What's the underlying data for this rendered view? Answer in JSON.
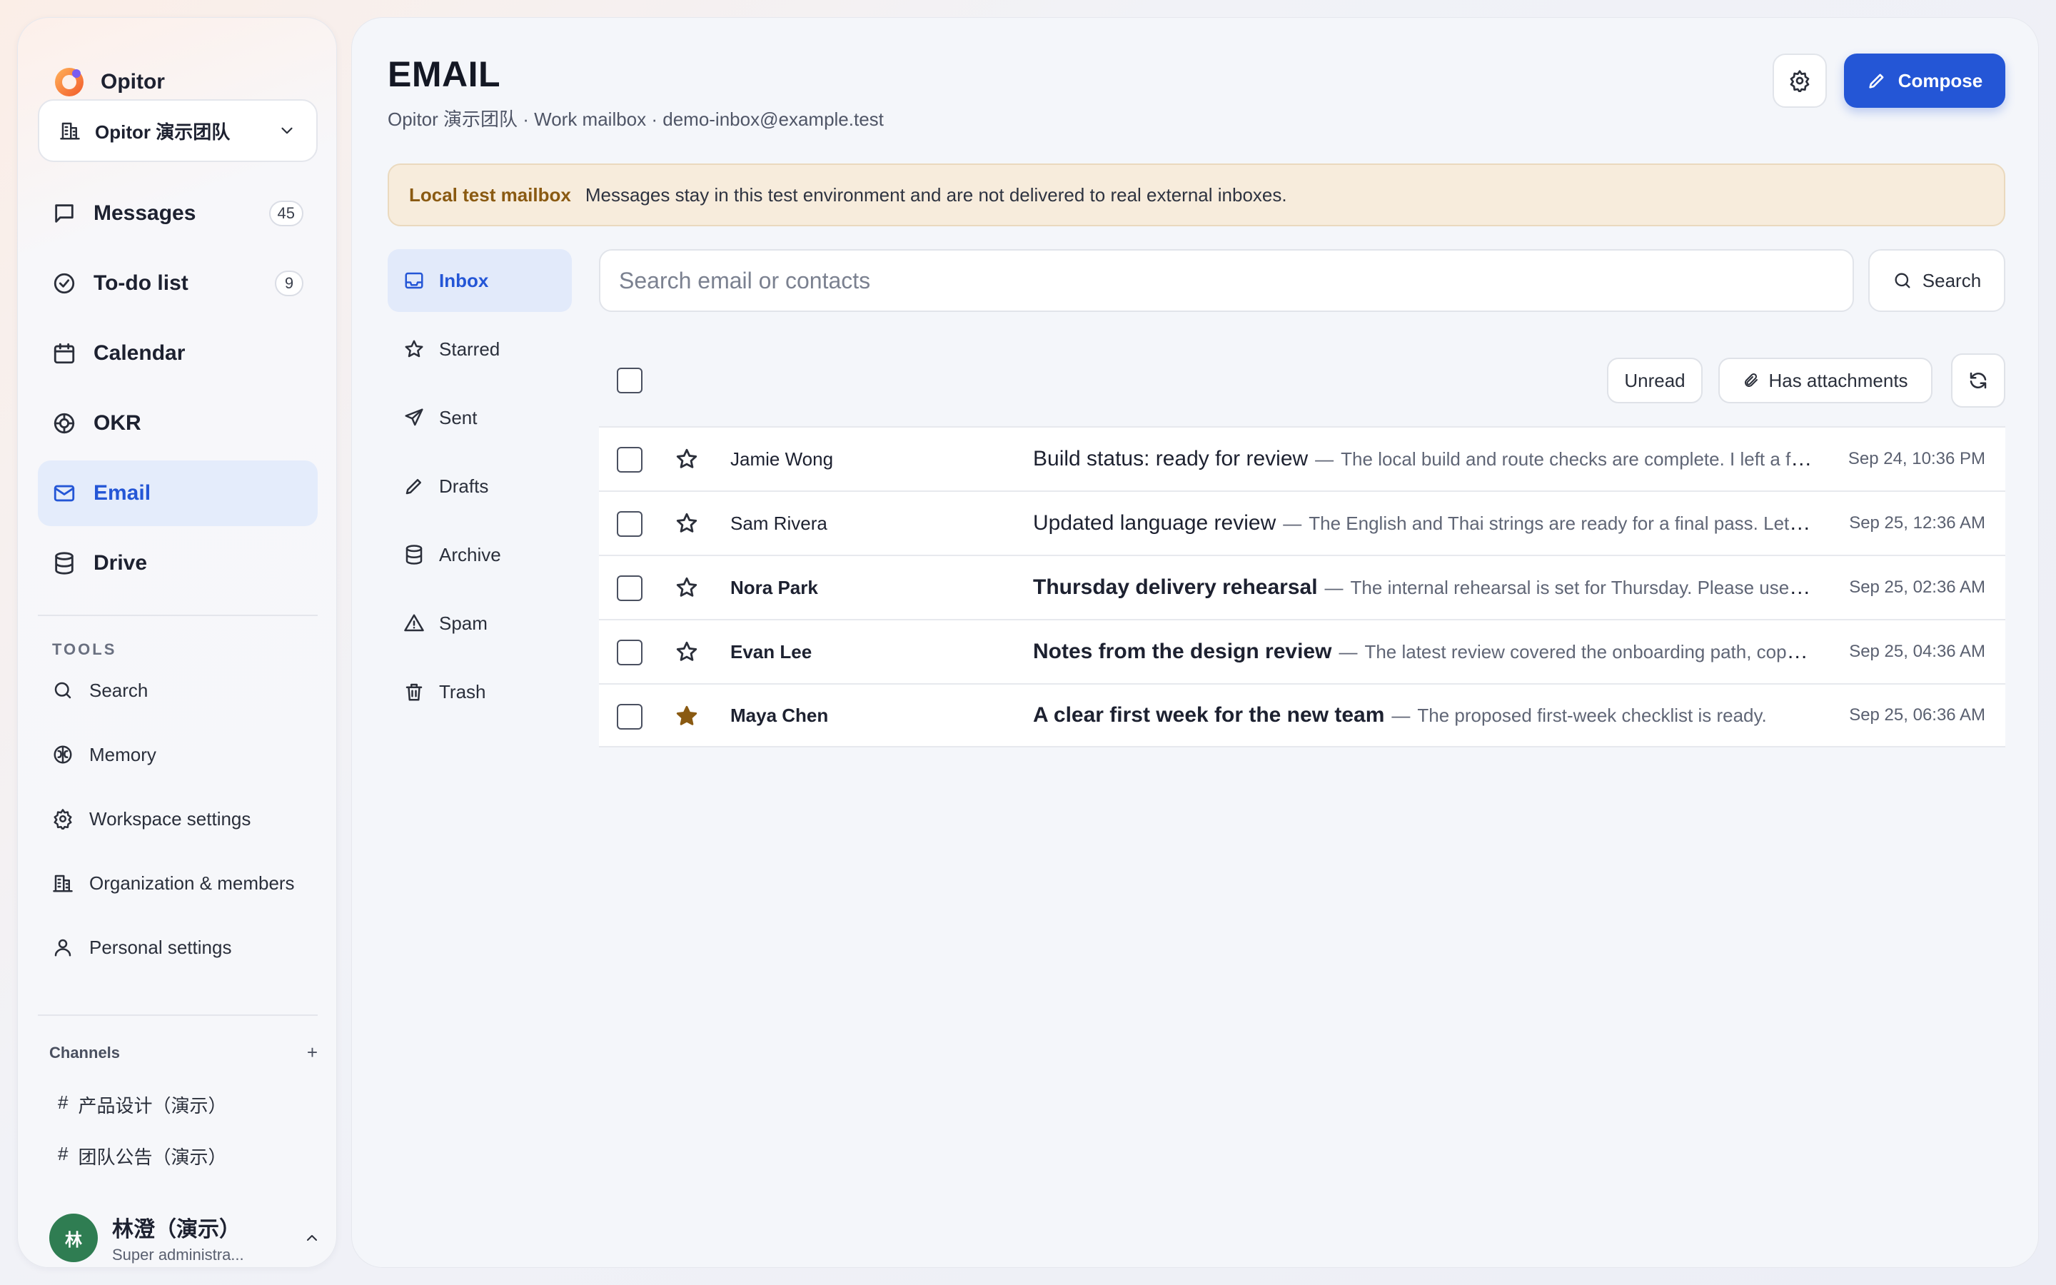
{
  "brand": {
    "name": "Opitor"
  },
  "workspace": {
    "name": "Opitor 演示团队"
  },
  "nav": [
    {
      "label": "Messages",
      "badge": "45",
      "icon": "message-icon"
    },
    {
      "label": "To-do list",
      "badge": "9",
      "icon": "check-circle-icon"
    },
    {
      "label": "Calendar",
      "badge": "",
      "icon": "calendar-icon"
    },
    {
      "label": "OKR",
      "badge": "",
      "icon": "target-icon"
    },
    {
      "label": "Email",
      "badge": "",
      "icon": "mail-icon",
      "active": true
    },
    {
      "label": "Drive",
      "badge": "",
      "icon": "database-icon"
    }
  ],
  "tools": {
    "title": "TOOLS",
    "items": [
      {
        "label": "Search",
        "icon": "search-icon"
      },
      {
        "label": "Memory",
        "icon": "brain-icon"
      },
      {
        "label": "Workspace settings",
        "icon": "gear-icon"
      },
      {
        "label": "Organization & members",
        "icon": "building-icon"
      },
      {
        "label": "Personal settings",
        "icon": "user-icon"
      }
    ]
  },
  "channels": {
    "title": "Channels",
    "add": "+",
    "items": [
      {
        "hash": "#",
        "label": "产品设计（演示）"
      },
      {
        "hash": "#",
        "label": "团队公告（演示）"
      }
    ]
  },
  "user": {
    "avatar": "林",
    "name": "林澄（演示）",
    "role": "Super administra..."
  },
  "header": {
    "title": "EMAIL",
    "subtitle": "Opitor 演示团队 · Work mailbox · demo-inbox@example.test",
    "compose_label": "Compose"
  },
  "notice": {
    "tag": "Local test mailbox",
    "text": "Messages stay in this test environment and are not delivered to real external inboxes."
  },
  "folders": [
    {
      "label": "Inbox",
      "icon": "inbox-icon",
      "active": true
    },
    {
      "label": "Starred",
      "icon": "star-icon"
    },
    {
      "label": "Sent",
      "icon": "send-icon"
    },
    {
      "label": "Drafts",
      "icon": "pencil-icon"
    },
    {
      "label": "Archive",
      "icon": "archive-icon"
    },
    {
      "label": "Spam",
      "icon": "warning-icon"
    },
    {
      "label": "Trash",
      "icon": "trash-icon"
    }
  ],
  "search": {
    "placeholder": "Search email or contacts",
    "button_label": "Search"
  },
  "filters": {
    "unread": "Unread",
    "attachments": "Has attachments"
  },
  "emails": [
    {
      "sender": "Jamie Wong",
      "subject": "Build status: ready for review",
      "snippet": "The local build and route checks are complete. I left a few notes for the next pass.",
      "date": "Sep 24, 10:36 PM",
      "starred": false,
      "unread": false
    },
    {
      "sender": "Sam Rivera",
      "subject": "Updated language review",
      "snippet": "The English and Thai strings are ready for a final pass. Let me know what to change.",
      "date": "Sep 25, 12:36 AM",
      "starred": false,
      "unread": false
    },
    {
      "sender": "Nora Park",
      "subject": "Thursday delivery rehearsal",
      "snippet": "The internal rehearsal is set for Thursday. Please use the shared agenda.",
      "date": "Sep 25, 02:36 AM",
      "starred": false,
      "unread": true
    },
    {
      "sender": "Evan Lee",
      "subject": "Notes from the design review",
      "snippet": "The latest review covered the onboarding path, copy and spacing.",
      "date": "Sep 25, 04:36 AM",
      "starred": false,
      "unread": true
    },
    {
      "sender": "Maya Chen",
      "subject": "A clear first week for the new team",
      "snippet": "The proposed first-week checklist is ready.",
      "date": "Sep 25, 06:36 AM",
      "starred": true,
      "unread": true
    }
  ],
  "colors": {
    "accent": "#2456d6",
    "star_filled": "#8a5a12",
    "notice_bg": "#f7ecdc"
  }
}
